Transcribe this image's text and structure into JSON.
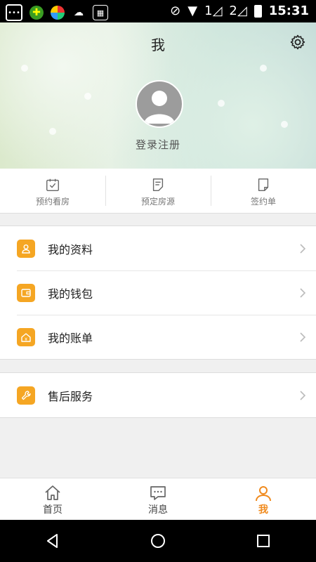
{
  "status_bar": {
    "time": "15:31",
    "sim1": "1",
    "sim2": "2"
  },
  "header": {
    "title": "我",
    "login_text": "登录注册"
  },
  "quick_actions": [
    {
      "label": "预约看房",
      "icon": "calendar-check-icon"
    },
    {
      "label": "预定房源",
      "icon": "document-edit-icon"
    },
    {
      "label": "签约单",
      "icon": "note-icon"
    }
  ],
  "menu_group1": [
    {
      "label": "我的资料",
      "icon": "person-icon"
    },
    {
      "label": "我的钱包",
      "icon": "wallet-icon"
    },
    {
      "label": "我的账单",
      "icon": "home-bill-icon"
    }
  ],
  "menu_group2": [
    {
      "label": "售后服务",
      "icon": "wrench-icon"
    }
  ],
  "bottom_nav": [
    {
      "label": "首页",
      "icon": "home-icon",
      "active": false
    },
    {
      "label": "消息",
      "icon": "message-icon",
      "active": false
    },
    {
      "label": "我",
      "icon": "person-icon",
      "active": true
    }
  ],
  "colors": {
    "accent": "#f5a623",
    "active_tab": "#f08a1d"
  }
}
